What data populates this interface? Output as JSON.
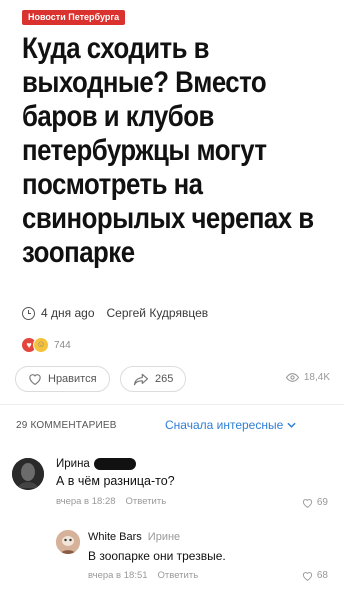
{
  "badge": "Новости Петербурга",
  "headline": "Куда сходить в выходные? Вместо баров и клубов петербуржцы могут посмотреть на свинорылых черепах в зоопарке",
  "meta": {
    "time": "4 дня ago",
    "author": "Сергей Кудрявцев"
  },
  "reactions": {
    "count": "744"
  },
  "actions": {
    "like_label": "Нравится",
    "share_count": "265",
    "views": "18,4K"
  },
  "comments_header": {
    "count_label": "29 КОММЕНТАРИЕВ",
    "sort_label": "Сначала интересные"
  },
  "comments": [
    {
      "author": "Ирина",
      "text": "А в чём разница-то?",
      "time": "вчера в 18:28",
      "reply": "Ответить",
      "likes": "69"
    },
    {
      "author": "White Bars",
      "reply_to": "Ирине",
      "text": "В зоопарке они трезвые.",
      "time": "вчера в 18:51",
      "reply": "Ответить",
      "likes": "68"
    }
  ],
  "colors": {
    "badge": "#d9322f",
    "link": "#2f7fd6"
  }
}
